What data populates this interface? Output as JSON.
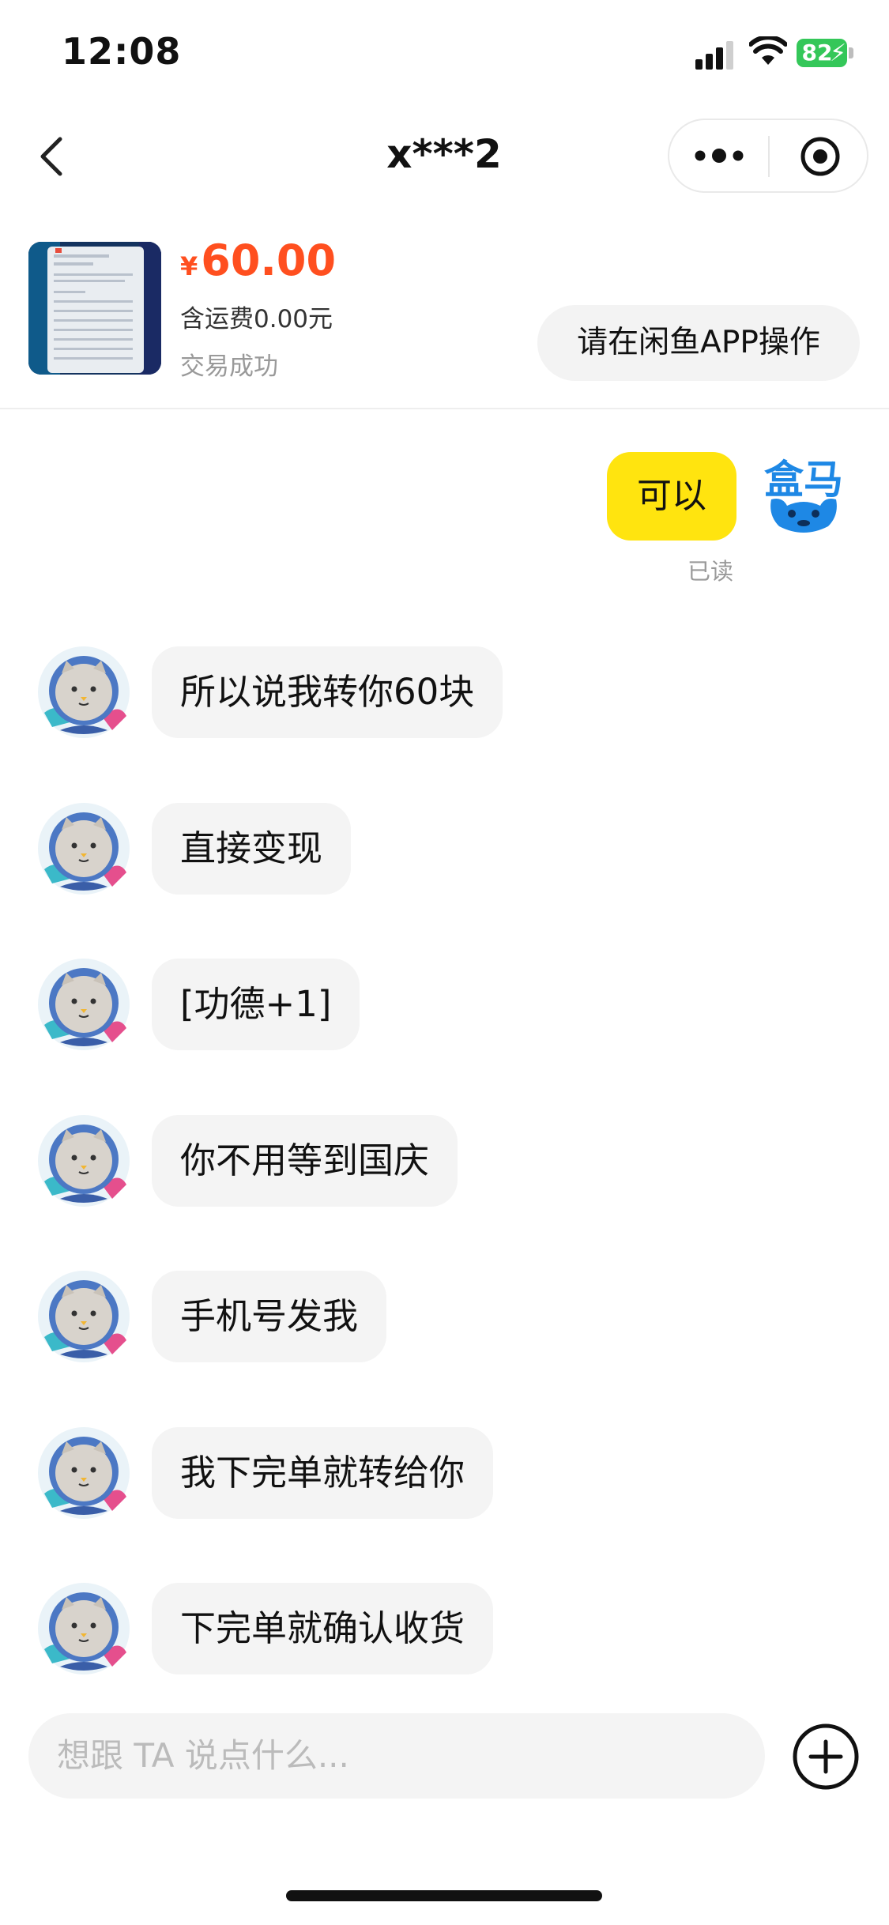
{
  "status_bar": {
    "time": "12:08",
    "battery": "82"
  },
  "nav": {
    "title": "x***2"
  },
  "product": {
    "currency": "¥",
    "price": "60.00",
    "shipping": "含运费0.00元",
    "status": "交易成功",
    "action_button": "请在闲鱼APP操作"
  },
  "my_message": {
    "text": "可以",
    "read_status": "已读",
    "avatar_brand": "盒马"
  },
  "messages": [
    {
      "text": "所以说我转你60块"
    },
    {
      "text": "直接变现"
    },
    {
      "text": "[功德+1]"
    },
    {
      "text": "你不用等到国庆"
    },
    {
      "text": "手机号发我"
    },
    {
      "text": "我下完单就转给你"
    },
    {
      "text": "下完单就确认收货"
    }
  ],
  "input": {
    "placeholder": "想跟 TA 说点什么..."
  },
  "colors": {
    "accent_yellow": "#ffe40f",
    "price_orange": "#ff4f1f",
    "battery_green": "#34c759"
  }
}
